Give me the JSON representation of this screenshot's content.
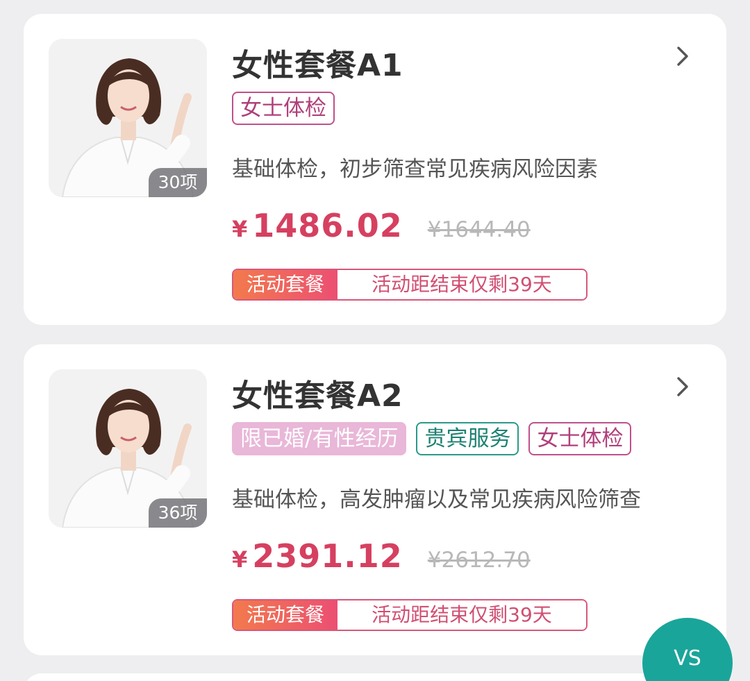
{
  "packages": [
    {
      "title": "女性套餐A1",
      "item_count": "30项",
      "tags": [
        {
          "label": "女士体检",
          "style": "pink"
        }
      ],
      "description": "基础体检，初步筛查常见疾病风险因素",
      "price_symbol": "¥",
      "price": "1486.02",
      "original_price": "¥1644.40",
      "promo_label": "活动套餐",
      "promo_countdown": "活动距结束仅剩39天"
    },
    {
      "title": "女性套餐A2",
      "item_count": "36项",
      "tags": [
        {
          "label": "限已婚/有性经历",
          "style": "filled"
        },
        {
          "label": "贵宾服务",
          "style": "green"
        },
        {
          "label": "女士体检",
          "style": "pink"
        }
      ],
      "description": "基础体检，高发肿瘤以及常见疾病风险筛查",
      "price_symbol": "¥",
      "price": "2391.12",
      "original_price": "¥2612.70",
      "promo_label": "活动套餐",
      "promo_countdown": "活动距结束仅剩39天"
    }
  ],
  "compare_button": {
    "label": "VS"
  },
  "icons": {
    "chevron": "chevron-right-icon"
  },
  "colors": {
    "price": "#d64060",
    "tag_pink": "#c0508b",
    "tag_green": "#2a9a8a",
    "tag_filled": "#e9b7d8",
    "promo_gradient_start": "#f27a4d",
    "promo_gradient_end": "#ec4f72",
    "vs_button": "#1aa59a"
  }
}
